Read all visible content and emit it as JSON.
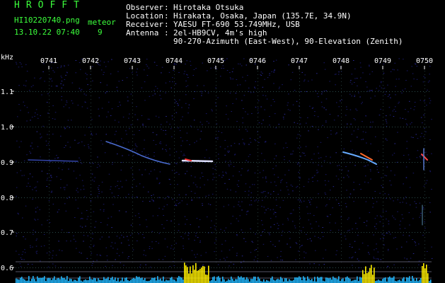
{
  "header": {
    "app_name": "HROFFT",
    "filename": "HI10220740.png",
    "datetime": "13.10.22 07:40",
    "meteor_label": "meteor",
    "meteor_count": "9"
  },
  "station": {
    "observer_label": "Observer",
    "observer": "Hirotaka Otsuka",
    "location_label": "Location",
    "location": "Hirakata, Osaka, Japan (135.7E, 34.9N)",
    "receiver_label": "Receiver",
    "receiver": "YAESU FT-690 53.749MHz, USB",
    "antenna_label": "Antenna",
    "antenna_line1": "2el-HB9CV, 4m's high",
    "antenna_line2": "90-270-Azimuth (East-West), 90-Elevation (Zenith)"
  },
  "axes": {
    "y_unit": "kHz",
    "y_ticks": [
      "1.1",
      "1.0",
      "0.9",
      "0.8",
      "0.7",
      "0.6"
    ],
    "x_ticks": [
      "0741",
      "0742",
      "0743",
      "0744",
      "0745",
      "0746",
      "0747",
      "0748",
      "0749",
      "0750"
    ]
  },
  "colors": {
    "background": "#000000",
    "header_green": "#3cff3c",
    "text": "#ffffff",
    "noise": "#1a1a6e",
    "level_bar": "#22b8ff",
    "level_peak": "#ffee00"
  }
}
